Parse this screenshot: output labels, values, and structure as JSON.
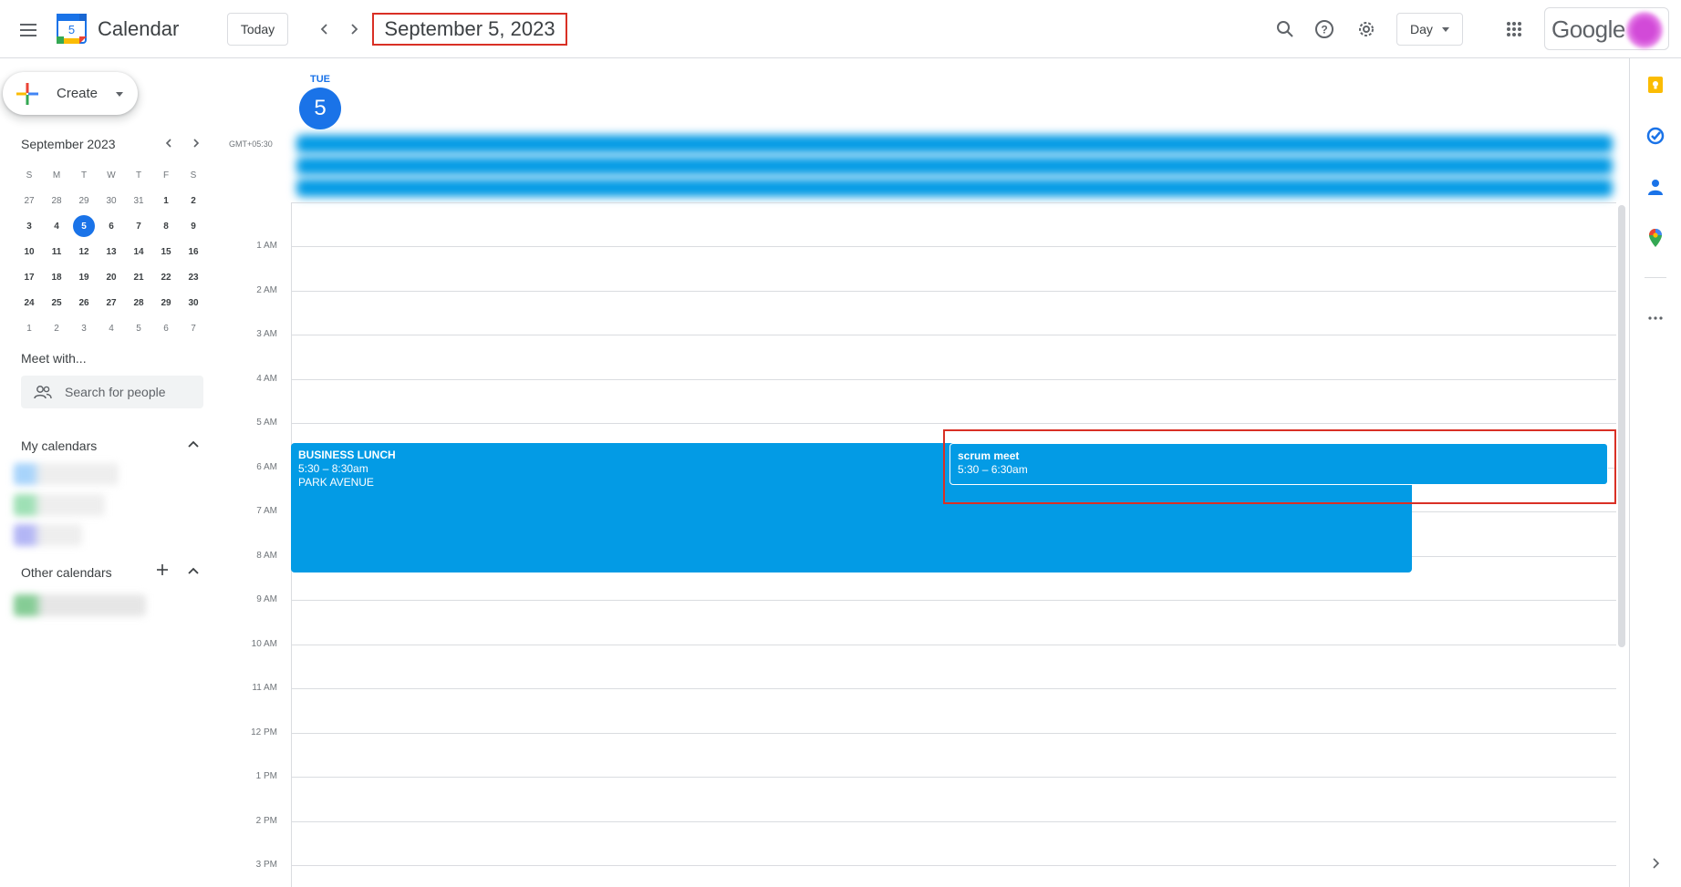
{
  "header": {
    "app_title": "Calendar",
    "logo_day": "5",
    "today_label": "Today",
    "date_title": "September 5, 2023",
    "view_label": "Day",
    "google_word": "Google"
  },
  "sidebar": {
    "create_label": "Create",
    "mini_calendar": {
      "month_label": "September 2023",
      "weekday_heads": [
        "S",
        "M",
        "T",
        "W",
        "T",
        "F",
        "S"
      ],
      "weeks": [
        [
          "27",
          "28",
          "29",
          "30",
          "31",
          "1",
          "2"
        ],
        [
          "3",
          "4",
          "5",
          "6",
          "7",
          "8",
          "9"
        ],
        [
          "10",
          "11",
          "12",
          "13",
          "14",
          "15",
          "16"
        ],
        [
          "17",
          "18",
          "19",
          "20",
          "21",
          "22",
          "23"
        ],
        [
          "24",
          "25",
          "26",
          "27",
          "28",
          "29",
          "30"
        ],
        [
          "1",
          "2",
          "3",
          "4",
          "5",
          "6",
          "7"
        ]
      ],
      "selected_day": "5"
    },
    "meet_with_title": "Meet with...",
    "search_people_placeholder": "Search for people",
    "my_calendars_title": "My calendars",
    "other_calendars_title": "Other calendars"
  },
  "day_view": {
    "weekday": "TUE",
    "day_number": "5",
    "timezone": "GMT+05:30",
    "hour_labels": [
      "1 AM",
      "2 AM",
      "3 AM",
      "4 AM",
      "5 AM",
      "6 AM",
      "7 AM",
      "8 AM",
      "9 AM",
      "10 AM",
      "11 AM",
      "12 PM",
      "1 PM",
      "2 PM",
      "3 PM"
    ],
    "events": [
      {
        "title": "BUSINESS LUNCH",
        "time": "5:30 – 8:30am",
        "location": "PARK AVENUE"
      },
      {
        "title": "scrum meet",
        "time": "5:30 – 6:30am"
      }
    ]
  },
  "colors": {
    "event_blue": "#039be5",
    "accent_blue": "#1a73e8",
    "highlight_red": "#d93025"
  }
}
